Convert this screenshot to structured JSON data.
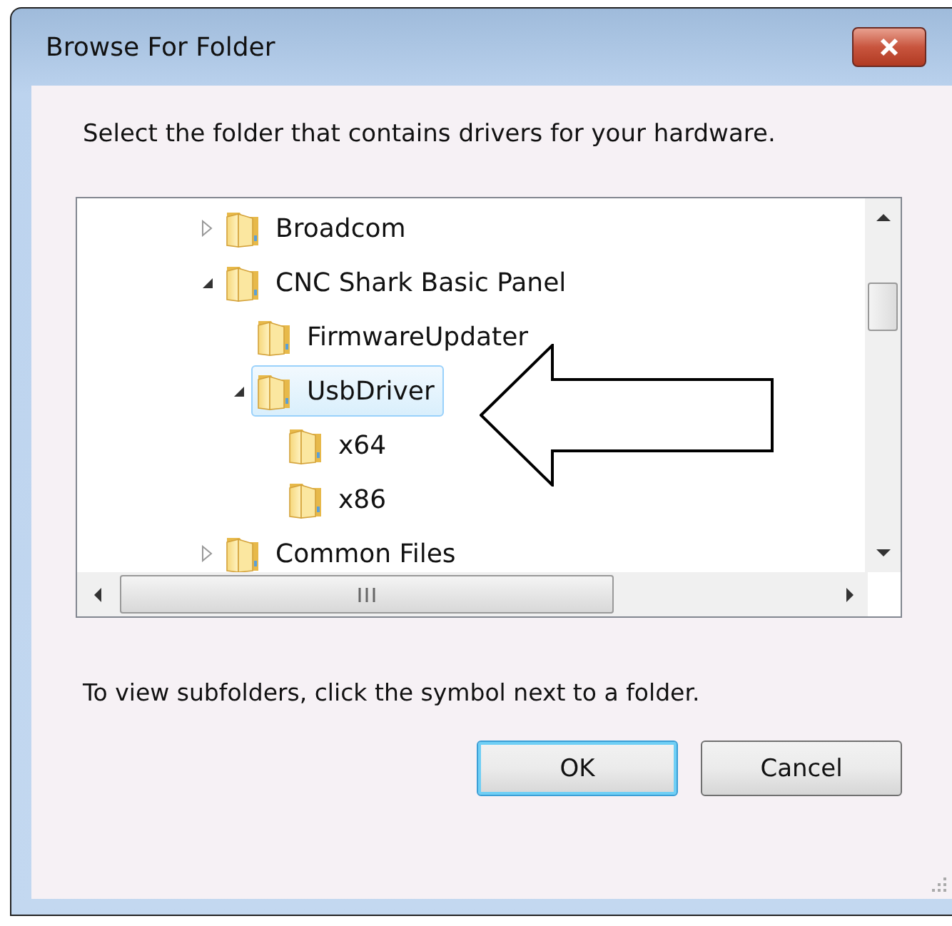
{
  "window": {
    "title": "Browse For Folder"
  },
  "instruction": "Select the folder that contains drivers for your hardware.",
  "tree": {
    "items": [
      {
        "label": "Broadcom",
        "expanded": false,
        "selected": false
      },
      {
        "label": "CNC Shark Basic Panel",
        "expanded": true,
        "selected": false,
        "children": [
          {
            "label": "FirmwareUpdater",
            "selected": false
          },
          {
            "label": "UsbDriver",
            "expanded": true,
            "selected": true,
            "children": [
              {
                "label": "x64",
                "selected": false
              },
              {
                "label": "x86",
                "selected": false
              }
            ]
          }
        ]
      },
      {
        "label": "Common Files",
        "expanded": false,
        "selected": false
      }
    ]
  },
  "callout": {
    "kind": "arrow"
  },
  "hint": "To view subfolders, click the symbol next to a folder.",
  "buttons": [
    {
      "label": "OK",
      "default": true
    },
    {
      "label": "Cancel",
      "default": false
    }
  ]
}
